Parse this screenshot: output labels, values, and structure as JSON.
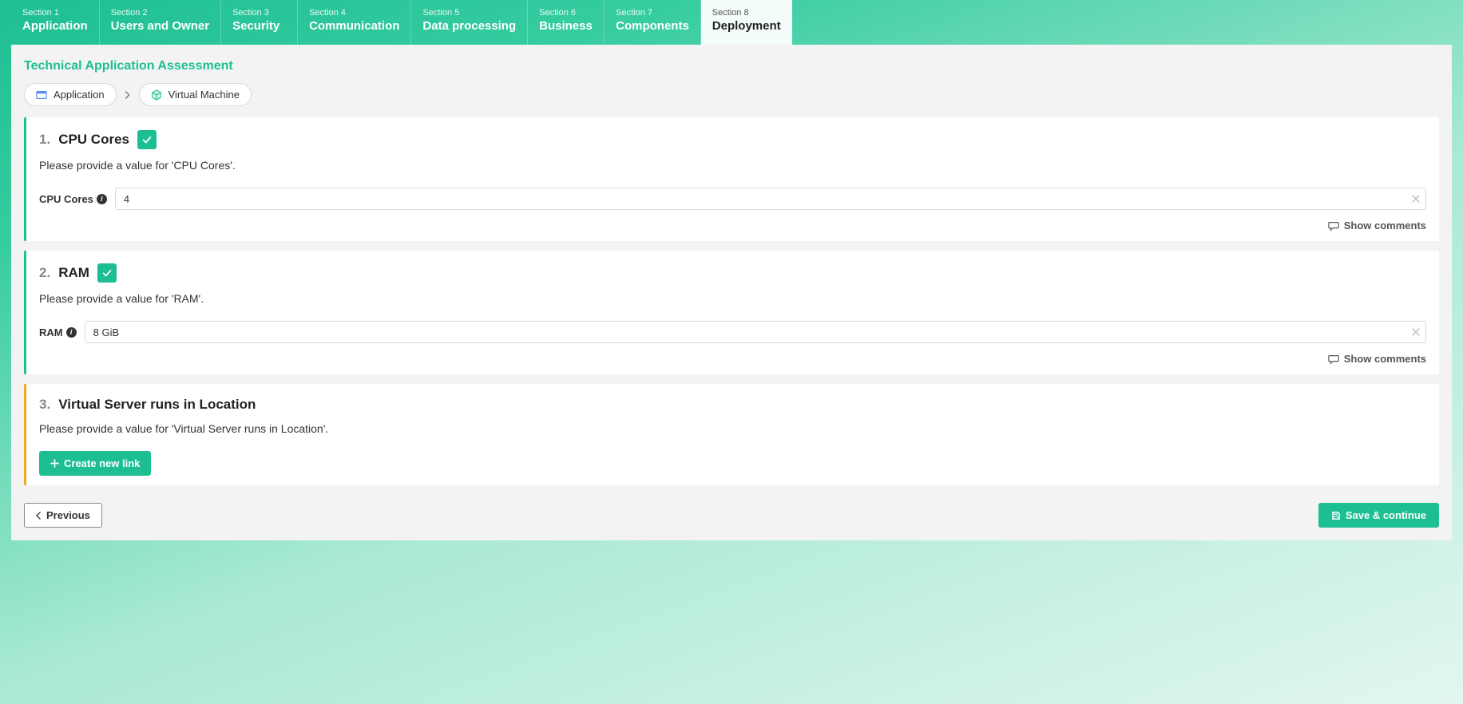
{
  "tabs": [
    {
      "num": "Section 1",
      "label": "Application"
    },
    {
      "num": "Section 2",
      "label": "Users and Owner"
    },
    {
      "num": "Section 3",
      "label": "Security"
    },
    {
      "num": "Section 4",
      "label": "Communication"
    },
    {
      "num": "Section 5",
      "label": "Data processing"
    },
    {
      "num": "Section 6",
      "label": "Business"
    },
    {
      "num": "Section 7",
      "label": "Components"
    },
    {
      "num": "Section 8",
      "label": "Deployment"
    }
  ],
  "page_title": "Technical Application Assessment",
  "breadcrumb": {
    "item1": "Application",
    "item2": "Virtual Machine"
  },
  "q1": {
    "num": "1.",
    "title": "CPU Cores",
    "desc": "Please provide a value for 'CPU Cores'.",
    "label": "CPU Cores",
    "value": "4",
    "comments": "Show comments"
  },
  "q2": {
    "num": "2.",
    "title": "RAM",
    "desc": "Please provide a value for 'RAM'.",
    "label": "RAM",
    "value": "8 GiB",
    "comments": "Show comments"
  },
  "q3": {
    "num": "3.",
    "title": "Virtual Server runs in Location",
    "desc": "Please provide a value for 'Virtual Server runs in Location'.",
    "create_link": "Create new link"
  },
  "footer": {
    "previous": "Previous",
    "save": "Save & continue"
  }
}
